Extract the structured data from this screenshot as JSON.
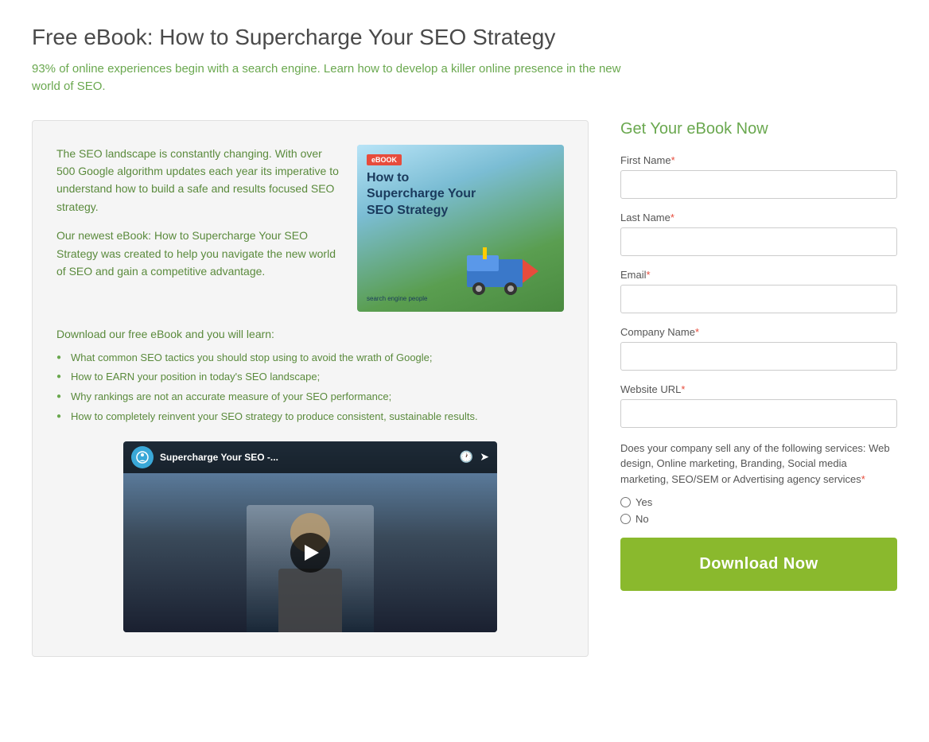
{
  "page": {
    "title": "Free eBook: How to Supercharge Your SEO Strategy",
    "subtitle": "93% of online experiences begin with a search engine. Learn how to develop a killer online presence in the new world of SEO.",
    "content": {
      "para1": "The SEO landscape is constantly changing. With over 500 Google algorithm updates each year its imperative to understand how to build a safe and results focused SEO strategy.",
      "para2": "Our newest eBook: How to Supercharge Your SEO Strategy was created to help you navigate the new world of SEO and gain a competitive advantage.",
      "download_intro": "Download our free eBook and you will learn:",
      "bullets": [
        "What common SEO tactics you should stop using to avoid the wrath of Google;",
        "How to EARN your position in today's SEO landscape;",
        "Why rankings are not an accurate measure of your SEO performance;",
        "How to completely reinvent your SEO strategy to produce consistent, sustainable results."
      ],
      "video": {
        "title": "Supercharge Your SEO -..."
      },
      "ebook": {
        "badge": "eBOOK",
        "title": "How to\nSupercharge Your\nSEO Strategy",
        "logo": "search engine people"
      }
    },
    "form": {
      "title": "Get Your eBook Now",
      "fields": [
        {
          "label": "First Name",
          "name": "first-name",
          "required": true
        },
        {
          "label": "Last Name",
          "name": "last-name",
          "required": true
        },
        {
          "label": "Email",
          "name": "email",
          "required": true
        },
        {
          "label": "Company Name",
          "name": "company-name",
          "required": true
        },
        {
          "label": "Website URL",
          "name": "website-url",
          "required": true
        }
      ],
      "services_question": "Does your company sell any of the following services: Web design, Online marketing, Branding, Social media marketing, SEO/SEM or Advertising agency services",
      "radio_options": [
        "Yes",
        "No"
      ],
      "submit_label": "Download Now"
    }
  }
}
